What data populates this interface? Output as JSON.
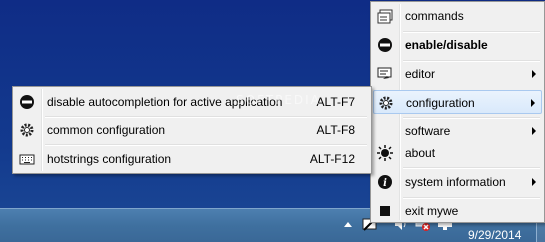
{
  "main_menu": {
    "items": [
      {
        "label": "commands",
        "icon": "commands-icon",
        "submenu": false,
        "bold": false
      },
      {
        "label": "enable/disable",
        "icon": "no-entry-icon",
        "submenu": false,
        "bold": true
      },
      {
        "label": "editor",
        "icon": "editor-icon",
        "submenu": true,
        "bold": false
      },
      {
        "label": "configuration",
        "icon": "gear-icon",
        "submenu": true,
        "bold": false,
        "highlighted": true
      },
      {
        "label": "software",
        "icon": "",
        "submenu": true,
        "bold": false
      },
      {
        "label": "about",
        "icon": "sun-icon",
        "submenu": false,
        "bold": false
      },
      {
        "label": "system information",
        "icon": "info-icon",
        "submenu": true,
        "bold": false
      },
      {
        "label": "exit mywe",
        "icon": "stop-square-icon",
        "submenu": false,
        "bold": false
      }
    ]
  },
  "sub_menu": {
    "items": [
      {
        "label": "disable autocompletion for active application",
        "shortcut": "ALT-F7",
        "icon": "no-entry-icon"
      },
      {
        "label": "common configuration",
        "shortcut": "ALT-F8",
        "icon": "gear-icon"
      },
      {
        "label": "hotstrings configuration",
        "shortcut": "ALT-F12",
        "icon": "keyboard-icon"
      }
    ]
  },
  "taskbar": {
    "clock_date": "9/29/2014"
  },
  "watermark": "SOFTPEDIA",
  "colors": {
    "menu_bg": "#f0f0f0",
    "highlight": "#d9e9fb",
    "desktop": "#133a8e",
    "taskbar": "#4070a0"
  }
}
